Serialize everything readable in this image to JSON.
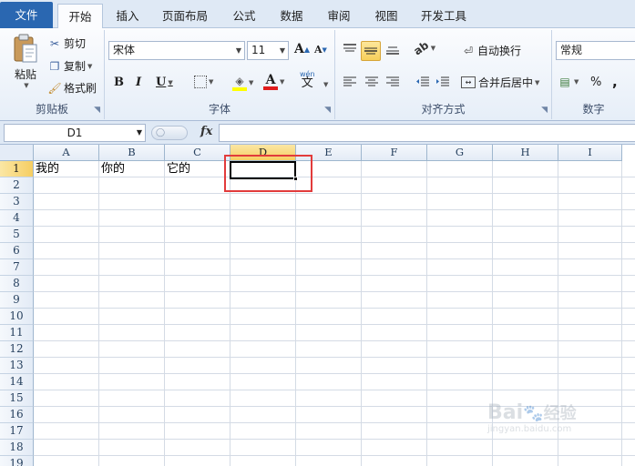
{
  "tabs": [
    {
      "id": "file",
      "label": "文件"
    },
    {
      "id": "home",
      "label": "开始"
    },
    {
      "id": "insert",
      "label": "插入"
    },
    {
      "id": "layout",
      "label": "页面布局"
    },
    {
      "id": "formula",
      "label": "公式"
    },
    {
      "id": "data",
      "label": "数据"
    },
    {
      "id": "review",
      "label": "审阅"
    },
    {
      "id": "view",
      "label": "视图"
    },
    {
      "id": "dev",
      "label": "开发工具"
    }
  ],
  "clipboard": {
    "paste_label": "粘贴",
    "cut_label": "剪切",
    "copy_label": "复制",
    "painter_label": "格式刷",
    "group_label": "剪贴板"
  },
  "font": {
    "font_name": "宋体",
    "font_size": "11",
    "bold": "B",
    "italic": "I",
    "underline": "U",
    "grow": "A",
    "shrink": "A",
    "phonetic": "wén",
    "phonetic_char": "文",
    "font_color_glyph": "A",
    "group_label": "字体"
  },
  "alignment": {
    "wrap_label": "自动换行",
    "merge_label": "合并后居中",
    "group_label": "对齐方式"
  },
  "number": {
    "format": "常规",
    "percent": "%",
    "comma": ",",
    "group_label": "数字"
  },
  "formula_bar": {
    "name_box": "D1",
    "fx": "fx",
    "value": ""
  },
  "sheet": {
    "columns": [
      "A",
      "B",
      "C",
      "D",
      "E",
      "F",
      "G",
      "H",
      "I"
    ],
    "rows": [
      "1",
      "2",
      "3",
      "4",
      "5",
      "6",
      "7",
      "8",
      "9",
      "10",
      "11",
      "12",
      "13",
      "14",
      "15",
      "16",
      "17",
      "18",
      "19"
    ],
    "active_column": "D",
    "active_row": "1",
    "cells": {
      "A1": "我的",
      "B1": "你的",
      "C1": "它的"
    }
  },
  "watermark": {
    "brand": "Bai",
    "brand2": "经验",
    "url": "jingyan.baidu.com"
  },
  "colors": {
    "file_tab": "#2a67b1",
    "highlight_border": "#e23b3b",
    "active_header": "#f6ce62"
  }
}
